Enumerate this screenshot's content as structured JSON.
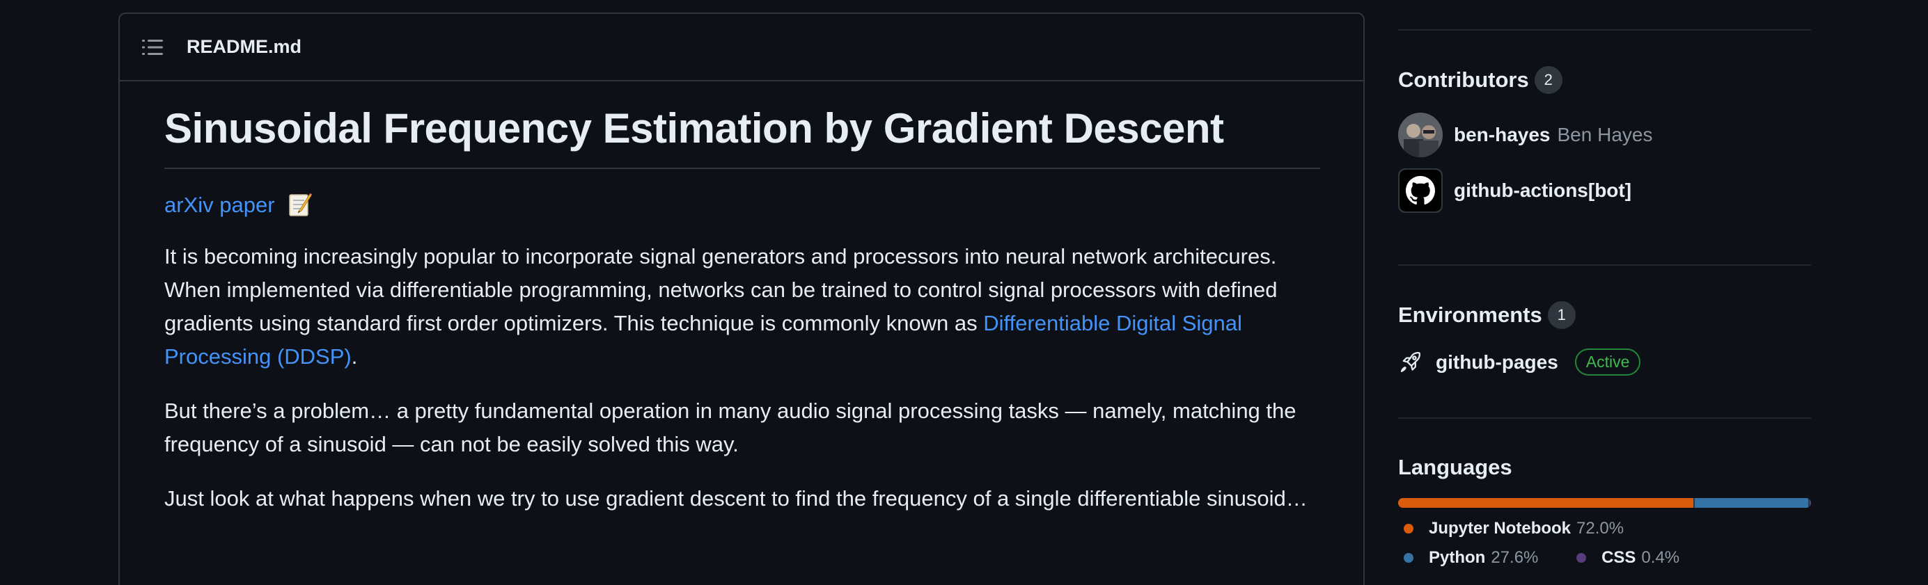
{
  "readme": {
    "filename": "README.md",
    "title": "Sinusoidal Frequency Estimation by Gradient Descent",
    "arxiv_link": "arXiv paper",
    "para1_text": "It is becoming increasingly popular to incorporate signal generators and processors into neural network architecures. When implemented via differentiable programming, networks can be trained to control signal processors with defined gradients using standard first order optimizers. This technique is commonly known as ",
    "para1_link": "Differentiable Digital Signal Processing (DDSP)",
    "para1_end": ".",
    "para2": "But there’s a problem… a pretty fundamental operation in many audio signal processing tasks — namely, matching the frequency of a sinusoid — can not be easily solved this way.",
    "para3": "Just look at what happens when we try to use gradient descent to find the frequency of a single differentiable sinusoid…"
  },
  "sidebar": {
    "contributors": {
      "title": "Contributors",
      "count": "2",
      "people": [
        {
          "login": "ben-hayes",
          "name": "Ben Hayes"
        },
        {
          "login": "github-actions[bot]",
          "name": ""
        }
      ]
    },
    "environments": {
      "title": "Environments",
      "count": "1",
      "items": [
        {
          "name": "github-pages",
          "status": "Active"
        }
      ]
    },
    "languages": {
      "title": "Languages",
      "items": [
        {
          "name": "Jupyter Notebook",
          "percent": "72.0%",
          "color": "#DA5B0B",
          "share": 72.0
        },
        {
          "name": "Python",
          "percent": "27.6%",
          "color": "#3572A5",
          "share": 27.6
        },
        {
          "name": "CSS",
          "percent": "0.4%",
          "color": "#563d7c",
          "share": 0.4
        }
      ]
    }
  }
}
